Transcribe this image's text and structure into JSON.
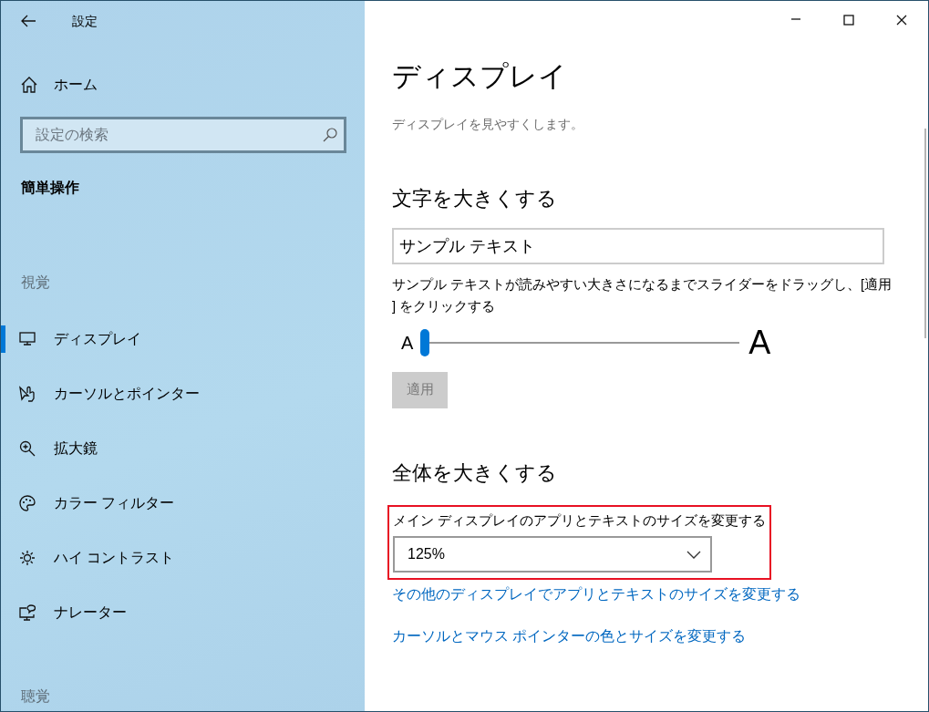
{
  "window": {
    "title": "設定"
  },
  "sidebar": {
    "home": "ホーム",
    "search": {
      "placeholder": "設定の検索"
    },
    "category": "簡単操作",
    "sections": [
      {
        "heading": "視覚",
        "items": [
          {
            "label": "ディスプレイ",
            "selected": true
          },
          {
            "label": "カーソルとポインター",
            "selected": false
          },
          {
            "label": "拡大鏡",
            "selected": false
          },
          {
            "label": "カラー フィルター",
            "selected": false
          },
          {
            "label": "ハイ コントラスト",
            "selected": false
          },
          {
            "label": "ナレーター",
            "selected": false
          }
        ]
      },
      {
        "heading": "聴覚"
      }
    ]
  },
  "content": {
    "title": "ディスプレイ",
    "subtitle": "ディスプレイを見やすくします。",
    "text_size": {
      "heading": "文字を大きくする",
      "sample": "サンプル テキスト",
      "instructions": "サンプル テキストが読みやすい大きさになるまでスライダーをドラッグし、[適用] をクリックする",
      "small_label": "A",
      "large_label": "A",
      "level": 0,
      "apply": {
        "label": "適用",
        "disabled": true
      }
    },
    "scale": {
      "heading": "全体を大きくする",
      "label": "メイン ディスプレイのアプリとテキストのサイズを変更する",
      "value": "125%",
      "highlighted": true,
      "links": [
        "その他のディスプレイでアプリとテキストのサイズを変更する",
        "カーソルとマウス ポインターの色とサイズを変更する"
      ]
    }
  }
}
